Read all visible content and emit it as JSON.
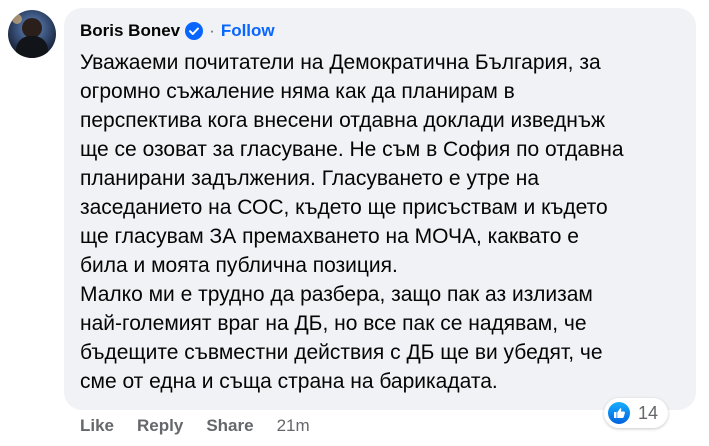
{
  "comment": {
    "author": "Boris Bonev",
    "follow_label": "Follow",
    "separator": "·",
    "text": "Уважаеми почитатели на Демократична България, за\nогромно съжаление няма как да планирам в\nперспектива кога внесени отдавна доклади изведнъж\nще се озоват за гласуване. Не съм в София по отдавна\nпланирани задължения. Гласуването е утре на\nзаседанието на СОС, където ще присъствам и където\nще гласувам ЗА премахването на МОЧА, каквато е\nбила и моята публична позиция.\nМалко ми е трудно да разбера, защо пак аз излизам\nнай-големият враг на ДБ, но все пак се надявам, че\nбъдещите съвместни действия с ДБ ще ви убедят, че\nсме от една и съща страна на барикадата.",
    "reactions": {
      "icon": "like-icon",
      "count": "14"
    },
    "actions": {
      "like": "Like",
      "reply": "Reply",
      "share": "Share",
      "time": "21m"
    }
  },
  "colors": {
    "bubble": "#f0f2f5",
    "follow": "#0866ff",
    "verified": "#0866ff",
    "meta": "#65676b",
    "text": "#050505"
  }
}
